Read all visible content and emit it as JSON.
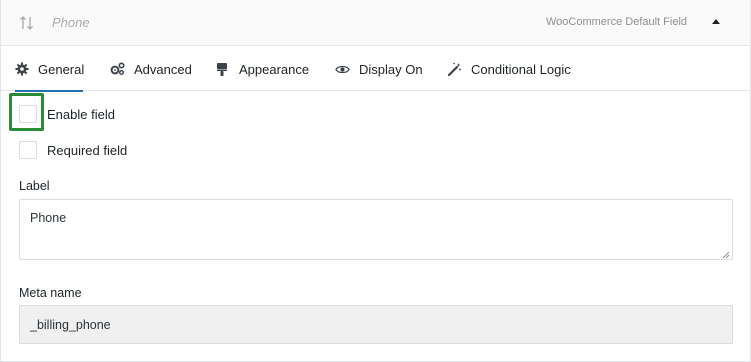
{
  "field_header": {
    "name": "Phone",
    "type_label": "WooCommerce Default Field",
    "sort_icon": "sort-arrows-icon",
    "toggle_icon": "caret-up-icon"
  },
  "tabs": [
    {
      "label": "General",
      "icon": "gear-icon",
      "active": true
    },
    {
      "label": "Advanced",
      "icon": "gears-icon",
      "active": false
    },
    {
      "label": "Appearance",
      "icon": "paint-brush-icon",
      "active": false
    },
    {
      "label": "Display On",
      "icon": "eye-icon",
      "active": false
    },
    {
      "label": "Conditional Logic",
      "icon": "magic-wand-icon",
      "active": false
    }
  ],
  "general": {
    "enable_field": {
      "label": "Enable field",
      "checked": false
    },
    "required_field": {
      "label": "Required field",
      "checked": false
    },
    "label_field": {
      "label": "Label",
      "value": "Phone"
    },
    "meta_name": {
      "label": "Meta name",
      "value": "_billing_phone"
    }
  },
  "colors": {
    "accent": "#2271b1",
    "highlight": "#2a8c36",
    "readonly_bg": "#f0f0f1"
  }
}
